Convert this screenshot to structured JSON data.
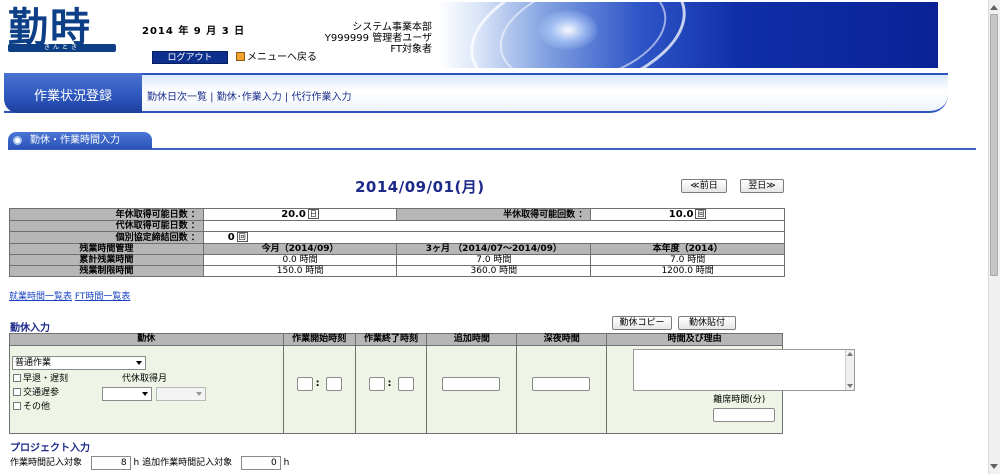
{
  "header": {
    "logo": {
      "text": "勤時",
      "sub": "きんとき"
    },
    "date": "2014 年 9 月 3 日",
    "logout_label": "ログアウト",
    "menu_back_label": "メニューへ戻る",
    "user_info": [
      "システム事業本部",
      "Y999999  管理者ユーザ",
      "FT対象者"
    ]
  },
  "nav": {
    "title": "作業状況登録",
    "links": [
      "勤休日次一覧",
      "勤休･作業入力",
      "代行作業入力"
    ],
    "separator": " | "
  },
  "section": {
    "title": "勤休・作業時間入力"
  },
  "date_nav": {
    "current_date": "2014/09/01(月)",
    "prev_label": "≪前日",
    "next_label": "翌日≫"
  },
  "summary": {
    "annual_leave_days_label": "年休取得可能日数  ：",
    "annual_leave_days_value": "20.0",
    "annual_leave_days_unit": "日",
    "half_leave_count_label": "半休取得可能回数  ：",
    "half_leave_count_value": "10.0",
    "half_leave_count_unit": "回",
    "comp_leave_days_label": "代休取得可能日数  ：",
    "individual_agreement_label": "個別協定締結回数  ：",
    "individual_agreement_value": "0",
    "individual_agreement_unit": "回",
    "overtime_header": "残業時間管理",
    "col_headers": [
      "今月（2014/09）",
      "3ヶ月  （2014/07～2014/09）",
      "本年度（2014）"
    ],
    "rows": [
      {
        "label": "累計残業時間",
        "values": [
          "0.0 時間",
          "7.0 時間",
          "7.0 時間"
        ]
      },
      {
        "label": "残業制限時間",
        "values": [
          "150.0 時間",
          "360.0 時間",
          "1200.0 時間"
        ]
      }
    ],
    "links": [
      "就業時間一覧表",
      "FT時間一覧表"
    ]
  },
  "work_input": {
    "title": "勤休入力",
    "copy_label": "勤休コピー",
    "paste_label": "勤休貼付",
    "columns": [
      "勤休",
      "作業開始時刻",
      "作業終了時刻",
      "追加時間",
      "深夜時間",
      "時間及び理由"
    ],
    "work_type": "普通作業",
    "checkboxes": [
      "早退・遅刻",
      "交通遅参",
      "その他"
    ],
    "comp_leave_label": "代休取得月",
    "time_separator": ":",
    "absence_label": "離席時間(分)"
  },
  "project_input": {
    "title": "プロジェクト入力",
    "work_time_label": "作業時間記入対象",
    "work_time_value": "8",
    "work_time_unit": "h",
    "extra_time_label": "追加作業時間記入対象",
    "extra_time_value": "0",
    "extra_time_unit": "h"
  }
}
